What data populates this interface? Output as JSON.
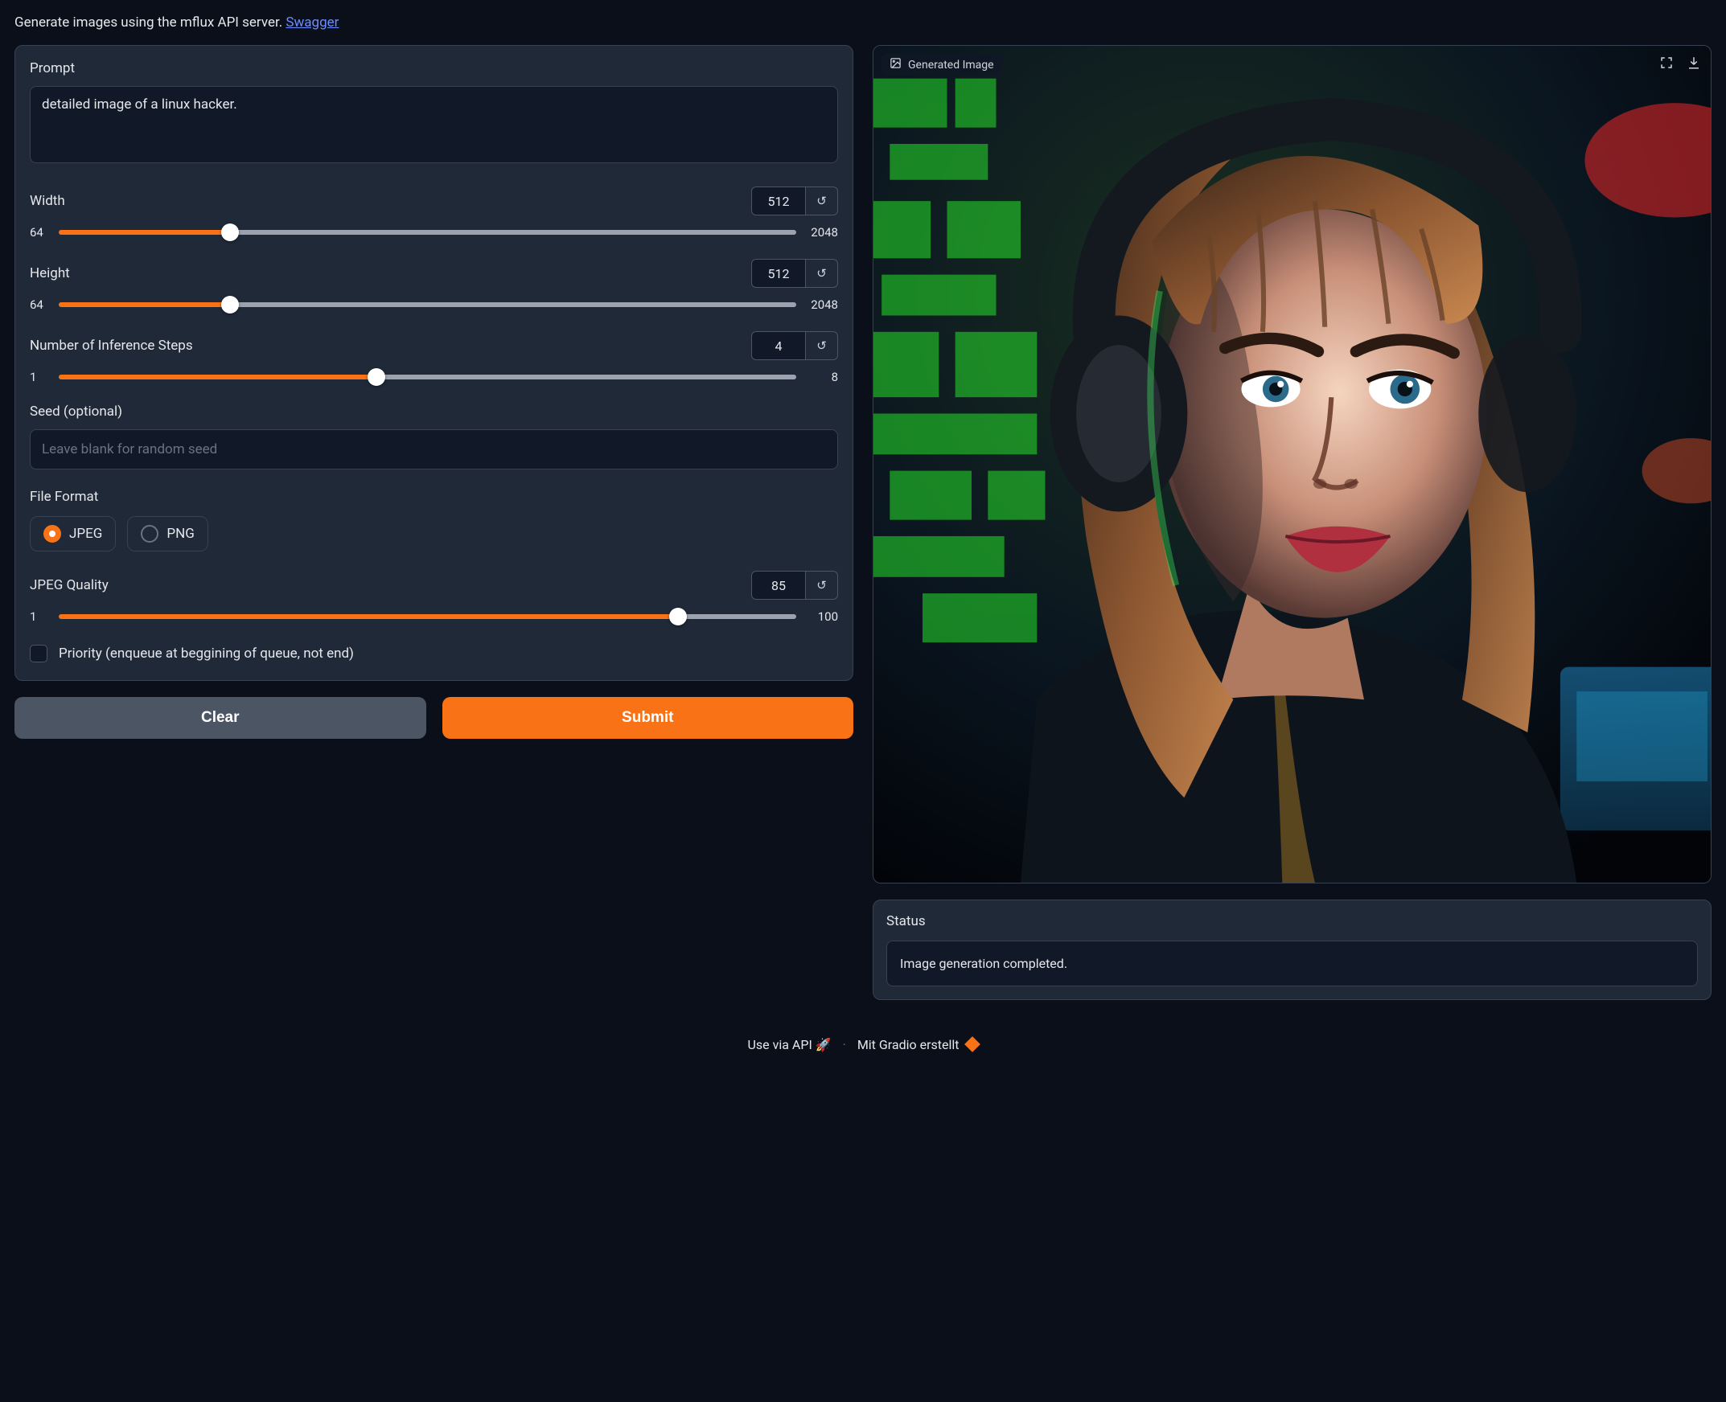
{
  "intro": {
    "text": "Generate images using the mflux API server. ",
    "link_label": "Swagger"
  },
  "form": {
    "prompt": {
      "label": "Prompt",
      "value": "detailed image of a linux hacker."
    },
    "width": {
      "label": "Width",
      "value": "512",
      "min": "64",
      "max": "2048",
      "percent": 22.6
    },
    "height": {
      "label": "Height",
      "value": "512",
      "min": "64",
      "max": "2048",
      "percent": 22.6
    },
    "steps": {
      "label": "Number of Inference Steps",
      "value": "4",
      "min": "1",
      "max": "8",
      "percent": 42.9
    },
    "seed": {
      "label": "Seed (optional)",
      "placeholder": "Leave blank for random seed",
      "value": ""
    },
    "file_format": {
      "label": "File Format",
      "options": [
        "JPEG",
        "PNG"
      ],
      "selected": 0
    },
    "jpeg_quality": {
      "label": "JPEG Quality",
      "value": "85",
      "min": "1",
      "max": "100",
      "percent": 84.8
    },
    "priority": {
      "label": "Priority (enqueue at beggining of queue, not end)",
      "checked": false
    },
    "buttons": {
      "clear": "Clear",
      "submit": "Submit"
    }
  },
  "output": {
    "image_label": "Generated Image",
    "status_label": "Status",
    "status_text": "Image generation completed."
  },
  "footer": {
    "api": "Use via API",
    "gradio": "Mit Gradio erstellt"
  }
}
